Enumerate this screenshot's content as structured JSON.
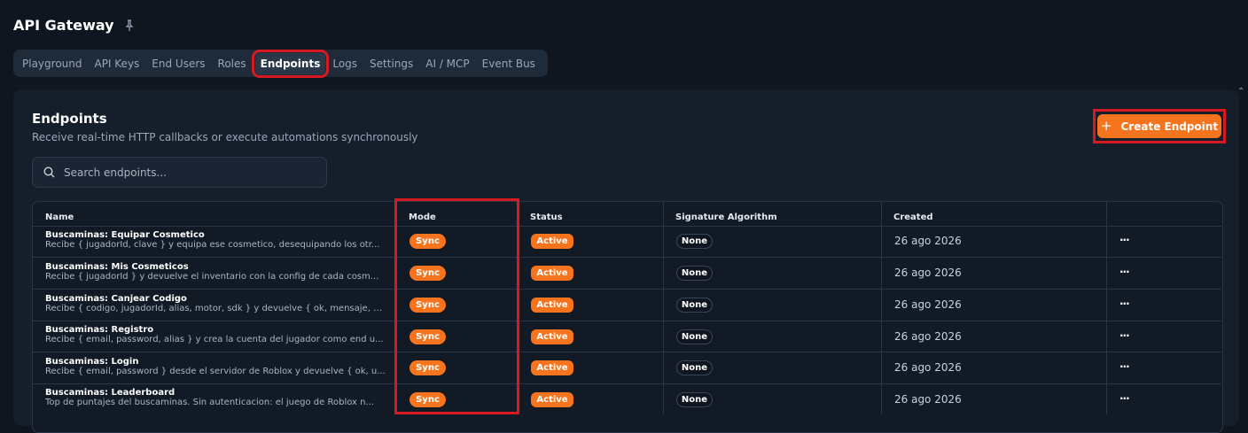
{
  "app": {
    "title": "API Gateway",
    "pin_icon": "pin-icon"
  },
  "tabs": [
    {
      "label": "Playground"
    },
    {
      "label": "API Keys"
    },
    {
      "label": "End Users"
    },
    {
      "label": "Roles"
    },
    {
      "label": "Endpoints",
      "active": true
    },
    {
      "label": "Logs"
    },
    {
      "label": "Settings"
    },
    {
      "label": "AI / MCP"
    },
    {
      "label": "Event Bus"
    }
  ],
  "section": {
    "title": "Endpoints",
    "subtitle": "Receive real-time HTTP callbacks or execute automations synchronously",
    "create_label": "Create Endpoint"
  },
  "search": {
    "placeholder": "Search endpoints..."
  },
  "table": {
    "headers": {
      "name": "Name",
      "mode": "Mode",
      "status": "Status",
      "sig": "Signature Algorithm",
      "created": "Created"
    },
    "rows": [
      {
        "name": "Buscaminas: Equipar Cosmetico",
        "desc": "Recibe { jugadorId, clave } y equipa ese cosmetico, desequipando los otr...",
        "mode": "Sync",
        "status": "Active",
        "sig": "None",
        "created": "26 ago 2026",
        "more": "···"
      },
      {
        "name": "Buscaminas: Mis Cosmeticos",
        "desc": "Recibe { jugadorId } y devuelve el inventario con la config de cada cosm...",
        "mode": "Sync",
        "status": "Active",
        "sig": "None",
        "created": "26 ago 2026",
        "more": "···"
      },
      {
        "name": "Buscaminas: Canjear Codigo",
        "desc": "Recibe { codigo, jugadorId, alias, motor, sdk } y devuelve { ok, mensaje, c...",
        "mode": "Sync",
        "status": "Active",
        "sig": "None",
        "created": "26 ago 2026",
        "more": "···"
      },
      {
        "name": "Buscaminas: Registro",
        "desc": "Recibe { email, password, alias } y crea la cuenta del jugador como end u...",
        "mode": "Sync",
        "status": "Active",
        "sig": "None",
        "created": "26 ago 2026",
        "more": "···"
      },
      {
        "name": "Buscaminas: Login",
        "desc": "Recibe { email, password } desde el servidor de Roblox y devuelve { ok, u...",
        "mode": "Sync",
        "status": "Active",
        "sig": "None",
        "created": "26 ago 2026",
        "more": "···"
      },
      {
        "name": "Buscaminas: Leaderboard",
        "desc": "Top de puntajes del buscaminas. Sin autenticacion: el juego de Roblox n...",
        "mode": "Sync",
        "status": "Active",
        "sig": "None",
        "created": "26 ago 2026",
        "more": "···"
      }
    ]
  },
  "colors": {
    "accent": "#f5741d",
    "highlight": "#d71921",
    "bg": "#0f1620"
  }
}
